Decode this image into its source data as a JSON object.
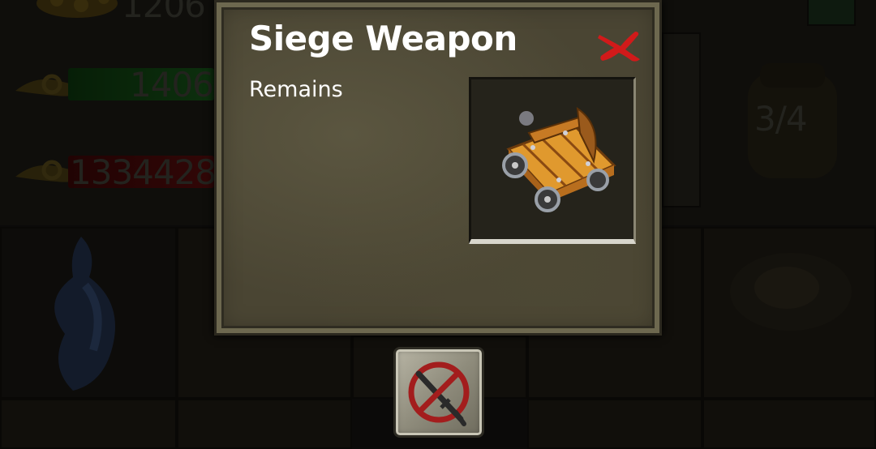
{
  "stats": {
    "gold_partial": "1206",
    "green_value": "1406",
    "red_value": "1334428",
    "capacity": "3/4"
  },
  "modal": {
    "title": "Siege Weapon",
    "subtitle": "Remains",
    "item_icon": "catapult-icon",
    "close_icon": "close-x-icon"
  },
  "action": {
    "icon": "no-weapon-icon"
  },
  "colors": {
    "title": "#ffffff",
    "close": "#d11a1a",
    "green_bar": "#1f8a23",
    "red_bar": "#9b1212"
  }
}
